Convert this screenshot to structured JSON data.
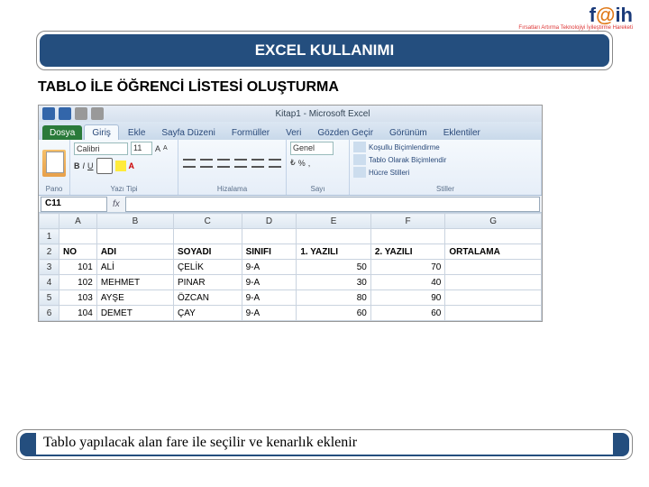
{
  "brand": {
    "pre": "f",
    "at": "@",
    "post": "ih",
    "tag": "Fırsatları Artırma Teknolojiyi İyileştirme Hareketi"
  },
  "title": "EXCEL KULLANIMI",
  "subheading": "TABLO İLE ÖĞRENCİ LİSTESİ OLUŞTURMA",
  "excel": {
    "window_title": "Kitap1 - Microsoft Excel",
    "tabs": [
      "Dosya",
      "Giriş",
      "Ekle",
      "Sayfa Düzeni",
      "Formüller",
      "Veri",
      "Gözden Geçir",
      "Görünüm",
      "Eklentiler"
    ],
    "active_tab": 1,
    "groups": {
      "pano": "Pano",
      "yazitipi": "Yazı Tipi",
      "hizalama": "Hizalama",
      "sayi": "Sayı",
      "stiller": "Stiller"
    },
    "font_name": "Calibri",
    "font_size": "11",
    "number_format": "Genel",
    "styles": {
      "kosullu": "Koşullu Biçimlendirme",
      "tablo": "Tablo Olarak Biçimlendir",
      "hucre": "Hücre Stilleri"
    },
    "namebox": "C11",
    "columns": [
      "A",
      "B",
      "C",
      "D",
      "E",
      "F",
      "G"
    ],
    "rows": [
      {
        "n": "1",
        "cells": [
          "",
          "",
          "",
          "",
          "",
          "",
          ""
        ]
      },
      {
        "n": "2",
        "cells": [
          "NO",
          "ADI",
          "SOYADI",
          "SINIFI",
          "1. YAZILI",
          "2. YAZILI",
          "ORTALAMA"
        ],
        "hdr": true
      },
      {
        "n": "3",
        "cells": [
          "101",
          "ALİ",
          "ÇELİK",
          "9-A",
          "50",
          "70",
          ""
        ]
      },
      {
        "n": "4",
        "cells": [
          "102",
          "MEHMET",
          "PINAR",
          "9-A",
          "30",
          "40",
          ""
        ]
      },
      {
        "n": "5",
        "cells": [
          "103",
          "AYŞE",
          "ÖZCAN",
          "9-A",
          "80",
          "90",
          ""
        ]
      },
      {
        "n": "6",
        "cells": [
          "104",
          "DEMET",
          "ÇAY",
          "9-A",
          "60",
          "60",
          ""
        ]
      }
    ]
  },
  "footer": "Tablo yapılacak alan fare ile seçilir ve kenarlık eklenir"
}
